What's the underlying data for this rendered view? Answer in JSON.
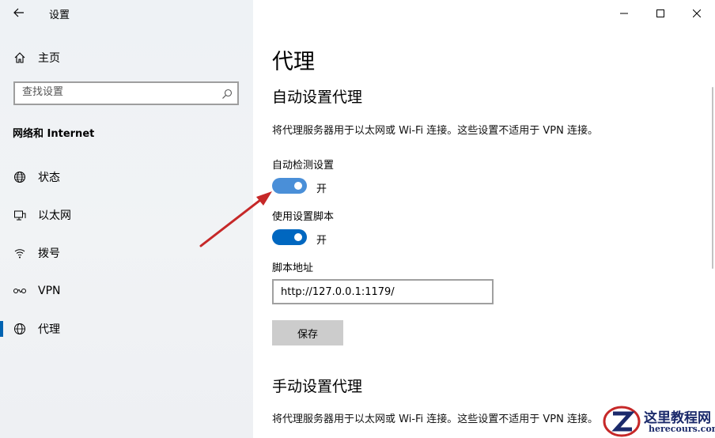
{
  "window": {
    "title": "设置",
    "controls": [
      "minimize-icon",
      "maximize-icon",
      "close-icon"
    ]
  },
  "sidebar": {
    "home_label": "主页",
    "search_placeholder": "查找设置",
    "section_title": "网络和 Internet",
    "items": [
      {
        "label": "状态",
        "icon": "globe-status-icon"
      },
      {
        "label": "以太网",
        "icon": "ethernet-icon"
      },
      {
        "label": "拨号",
        "icon": "dialup-icon"
      },
      {
        "label": "VPN",
        "icon": "vpn-icon"
      },
      {
        "label": "代理",
        "icon": "globe-icon",
        "active": true
      }
    ],
    "active_color": "#0063b1"
  },
  "main": {
    "page_title": "代理",
    "auto": {
      "heading": "自动设置代理",
      "description": "将代理服务器用于以太网或 Wi-Fi 连接。这些设置不适用于 VPN 连接。",
      "detect_label": "自动检测设置",
      "detect_state": "开",
      "script_label": "使用设置脚本",
      "script_state": "开",
      "address_label": "脚本地址",
      "address_value": "http://127.0.0.1:1179/",
      "save_label": "保存"
    },
    "manual": {
      "heading": "手动设置代理",
      "description": "将代理服务器用于以太网或 Wi-Fi 连接。这些设置不适用于 VPN 连接。"
    },
    "toggle_on_color": "#0067c0",
    "toggle_hover_color": "#4a8fd8"
  },
  "watermark": {
    "text": "这里教程网",
    "sub": "herecours.com"
  }
}
